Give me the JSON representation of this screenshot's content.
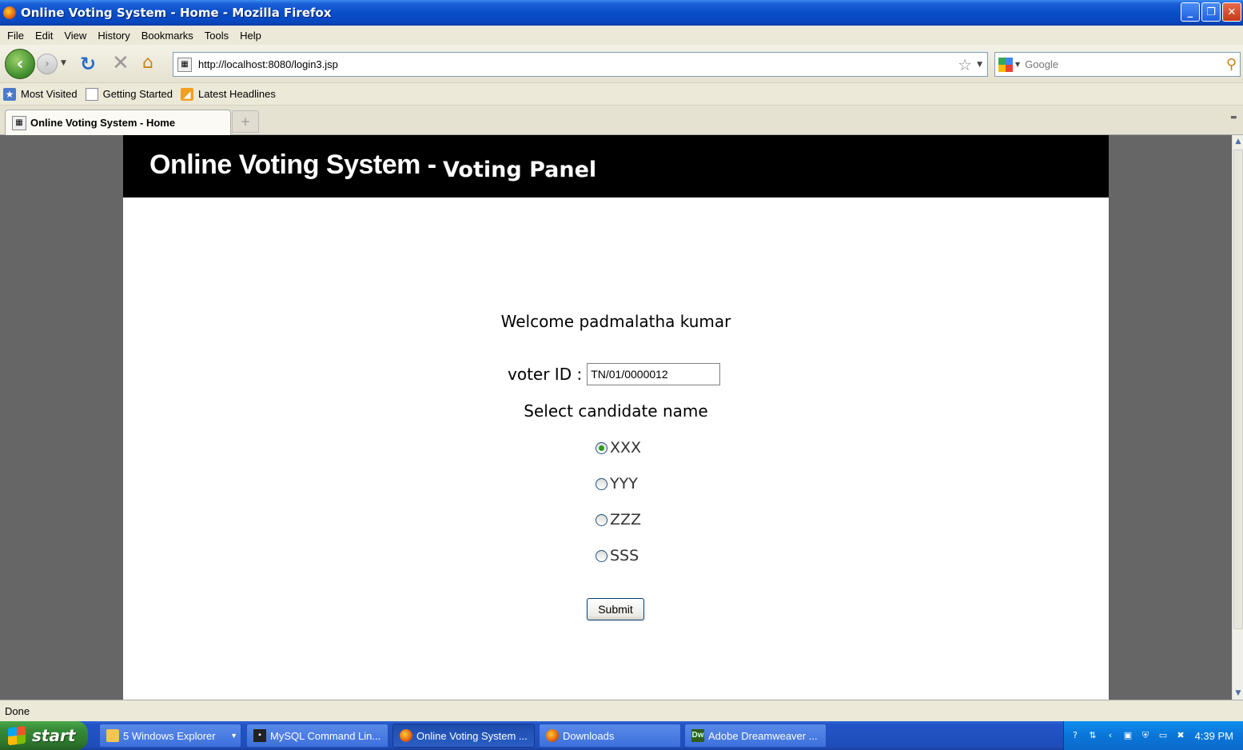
{
  "window": {
    "title": "Online Voting System - Home - Mozilla Firefox"
  },
  "menu": [
    "File",
    "Edit",
    "View",
    "History",
    "Bookmarks",
    "Tools",
    "Help"
  ],
  "nav": {
    "url": "http://localhost:8080/login3.jsp",
    "search_placeholder": "Google"
  },
  "bookmarks": [
    "Most Visited",
    "Getting Started",
    "Latest Headlines"
  ],
  "tab": {
    "label": "Online Voting System - Home"
  },
  "page": {
    "header_title": "Online Voting System  -",
    "header_subtitle": "Voting Panel",
    "welcome": "Welcome padmalatha kumar",
    "voter_label": "voter ID :",
    "voter_id": "TN/01/0000012",
    "select_title": "Select candidate name",
    "candidates": [
      {
        "label": "XXX",
        "selected": true
      },
      {
        "label": "YYY",
        "selected": false
      },
      {
        "label": "ZZZ",
        "selected": false
      },
      {
        "label": "SSS",
        "selected": false
      }
    ],
    "submit_label": "Submit"
  },
  "status": {
    "text": "Done"
  },
  "taskbar": {
    "start_label": "start",
    "tasks": [
      {
        "label": "5 Windows Explorer",
        "icon": "folder-icon"
      },
      {
        "label": "MySQL Command Lin...",
        "icon": "mysql-icon"
      },
      {
        "label": "Online Voting System ...",
        "icon": "firefox-icon"
      },
      {
        "label": "Downloads",
        "icon": "firefox-icon"
      },
      {
        "label": "Adobe Dreamweaver ...",
        "icon": "dreamweaver-icon"
      }
    ],
    "clock": "4:39 PM"
  },
  "colors": {
    "page_background": "#666666",
    "header_background": "#000000",
    "radio_checked": "#2f9c1e"
  }
}
